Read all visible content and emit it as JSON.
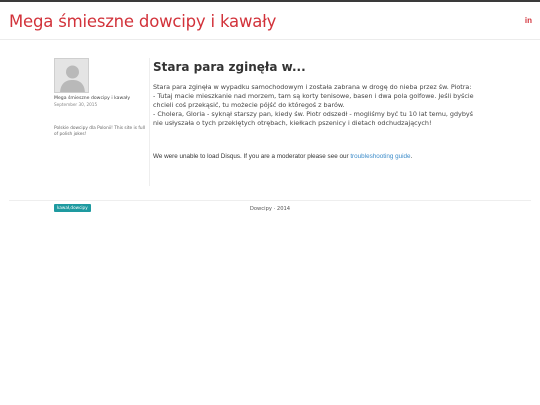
{
  "header": {
    "site_title": "Mega śmieszne dowcipy i kawały",
    "social_icon_label": "in"
  },
  "sidebar": {
    "avatar_icon": "default-user-silhouette",
    "author_name": "Mega śmieszne dowcipy i kawały",
    "post_date": "September 30, 2015",
    "bio": "Polskie dowcipy dla Polonii! This site is full of polish jokes!",
    "tag": "kawał,dowcipy"
  },
  "post": {
    "title": "Stara para zginęła w...",
    "lines": [
      "Stara para zginęła w wypadku samochodowym i została zabrana w drogę do nieba przez św. Piotra:",
      "- Tutaj macie mieszkanie nad morzem, tam są korty tenisowe, basen i dwa pola golfowe. Jeśli byście chcieli coś przekąsić, tu możecie pójść do któregoś z barów.",
      "- Cholera, Gloria - syknął starszy pan, kiedy św. Piotr odszedł - mogliśmy być tu 10 lat temu, gdybyś nie usłyszała o tych przeklętych otrębach, kiełkach pszenicy i dietach odchudzających!"
    ]
  },
  "disqus": {
    "message": "We were unable to load Disqus. If you are a moderator please see our ",
    "link_text": "troubleshooting guide",
    "suffix": "."
  },
  "footer": {
    "text": "Dowcipy · 2014"
  },
  "colors": {
    "brand": "#d2323a",
    "tag_bg": "#1e9aa0",
    "link": "#3b8bc9"
  }
}
